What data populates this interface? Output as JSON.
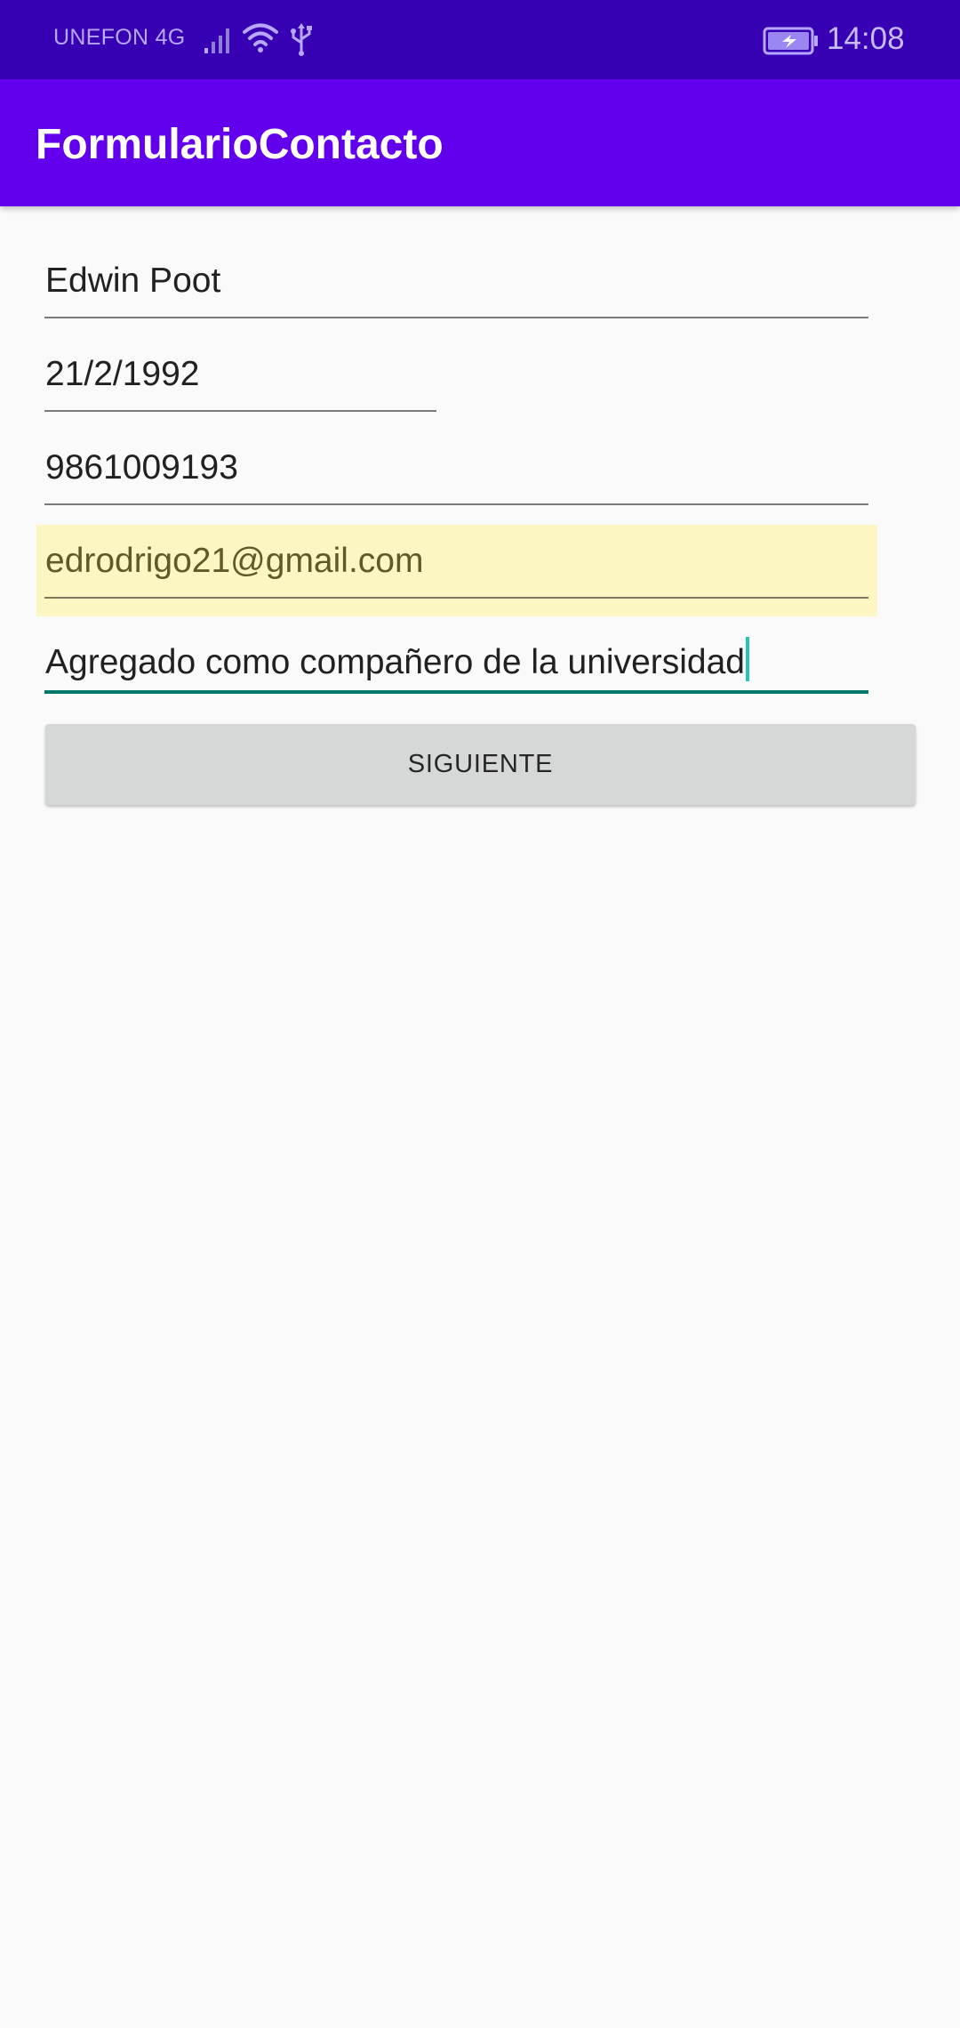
{
  "status_bar": {
    "carrier": "UNEFON 4G",
    "time": "14:08",
    "icons": [
      "signal-icon",
      "wifi-icon",
      "usb-icon",
      "battery-icon"
    ]
  },
  "app_bar": {
    "title": "FormularioContacto"
  },
  "form": {
    "name": "Edwin Poot",
    "birthdate": "21/2/1992",
    "phone": "9861009193",
    "email": "edrodrigo21@gmail.com",
    "description": "Agregado como compañero de la universidad"
  },
  "button": {
    "label": "SIGUIENTE"
  },
  "colors": {
    "status_bar": "#3700b3",
    "app_bar": "#6200ee",
    "focused_underline": "#00796b",
    "autofill_highlight": "#fcf6c2",
    "button": "#d6d7d7"
  }
}
